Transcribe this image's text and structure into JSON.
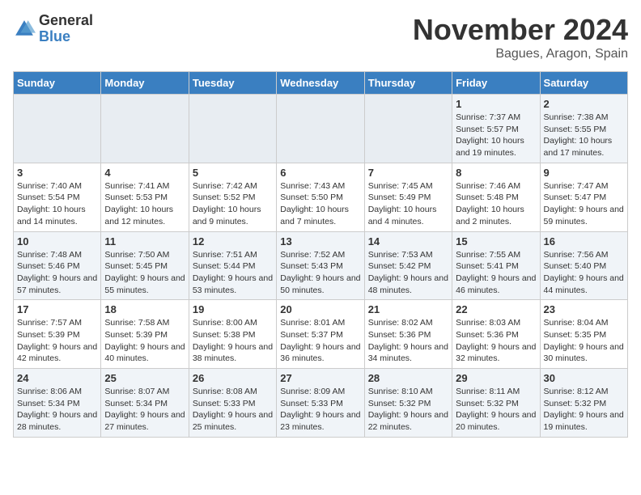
{
  "header": {
    "logo_general": "General",
    "logo_blue": "Blue",
    "month_title": "November 2024",
    "location": "Bagues, Aragon, Spain"
  },
  "weekdays": [
    "Sunday",
    "Monday",
    "Tuesday",
    "Wednesday",
    "Thursday",
    "Friday",
    "Saturday"
  ],
  "weeks": [
    [
      {
        "day": "",
        "info": ""
      },
      {
        "day": "",
        "info": ""
      },
      {
        "day": "",
        "info": ""
      },
      {
        "day": "",
        "info": ""
      },
      {
        "day": "",
        "info": ""
      },
      {
        "day": "1",
        "info": "Sunrise: 7:37 AM\nSunset: 5:57 PM\nDaylight: 10 hours and 19 minutes."
      },
      {
        "day": "2",
        "info": "Sunrise: 7:38 AM\nSunset: 5:55 PM\nDaylight: 10 hours and 17 minutes."
      }
    ],
    [
      {
        "day": "3",
        "info": "Sunrise: 7:40 AM\nSunset: 5:54 PM\nDaylight: 10 hours and 14 minutes."
      },
      {
        "day": "4",
        "info": "Sunrise: 7:41 AM\nSunset: 5:53 PM\nDaylight: 10 hours and 12 minutes."
      },
      {
        "day": "5",
        "info": "Sunrise: 7:42 AM\nSunset: 5:52 PM\nDaylight: 10 hours and 9 minutes."
      },
      {
        "day": "6",
        "info": "Sunrise: 7:43 AM\nSunset: 5:50 PM\nDaylight: 10 hours and 7 minutes."
      },
      {
        "day": "7",
        "info": "Sunrise: 7:45 AM\nSunset: 5:49 PM\nDaylight: 10 hours and 4 minutes."
      },
      {
        "day": "8",
        "info": "Sunrise: 7:46 AM\nSunset: 5:48 PM\nDaylight: 10 hours and 2 minutes."
      },
      {
        "day": "9",
        "info": "Sunrise: 7:47 AM\nSunset: 5:47 PM\nDaylight: 9 hours and 59 minutes."
      }
    ],
    [
      {
        "day": "10",
        "info": "Sunrise: 7:48 AM\nSunset: 5:46 PM\nDaylight: 9 hours and 57 minutes."
      },
      {
        "day": "11",
        "info": "Sunrise: 7:50 AM\nSunset: 5:45 PM\nDaylight: 9 hours and 55 minutes."
      },
      {
        "day": "12",
        "info": "Sunrise: 7:51 AM\nSunset: 5:44 PM\nDaylight: 9 hours and 53 minutes."
      },
      {
        "day": "13",
        "info": "Sunrise: 7:52 AM\nSunset: 5:43 PM\nDaylight: 9 hours and 50 minutes."
      },
      {
        "day": "14",
        "info": "Sunrise: 7:53 AM\nSunset: 5:42 PM\nDaylight: 9 hours and 48 minutes."
      },
      {
        "day": "15",
        "info": "Sunrise: 7:55 AM\nSunset: 5:41 PM\nDaylight: 9 hours and 46 minutes."
      },
      {
        "day": "16",
        "info": "Sunrise: 7:56 AM\nSunset: 5:40 PM\nDaylight: 9 hours and 44 minutes."
      }
    ],
    [
      {
        "day": "17",
        "info": "Sunrise: 7:57 AM\nSunset: 5:39 PM\nDaylight: 9 hours and 42 minutes."
      },
      {
        "day": "18",
        "info": "Sunrise: 7:58 AM\nSunset: 5:39 PM\nDaylight: 9 hours and 40 minutes."
      },
      {
        "day": "19",
        "info": "Sunrise: 8:00 AM\nSunset: 5:38 PM\nDaylight: 9 hours and 38 minutes."
      },
      {
        "day": "20",
        "info": "Sunrise: 8:01 AM\nSunset: 5:37 PM\nDaylight: 9 hours and 36 minutes."
      },
      {
        "day": "21",
        "info": "Sunrise: 8:02 AM\nSunset: 5:36 PM\nDaylight: 9 hours and 34 minutes."
      },
      {
        "day": "22",
        "info": "Sunrise: 8:03 AM\nSunset: 5:36 PM\nDaylight: 9 hours and 32 minutes."
      },
      {
        "day": "23",
        "info": "Sunrise: 8:04 AM\nSunset: 5:35 PM\nDaylight: 9 hours and 30 minutes."
      }
    ],
    [
      {
        "day": "24",
        "info": "Sunrise: 8:06 AM\nSunset: 5:34 PM\nDaylight: 9 hours and 28 minutes."
      },
      {
        "day": "25",
        "info": "Sunrise: 8:07 AM\nSunset: 5:34 PM\nDaylight: 9 hours and 27 minutes."
      },
      {
        "day": "26",
        "info": "Sunrise: 8:08 AM\nSunset: 5:33 PM\nDaylight: 9 hours and 25 minutes."
      },
      {
        "day": "27",
        "info": "Sunrise: 8:09 AM\nSunset: 5:33 PM\nDaylight: 9 hours and 23 minutes."
      },
      {
        "day": "28",
        "info": "Sunrise: 8:10 AM\nSunset: 5:32 PM\nDaylight: 9 hours and 22 minutes."
      },
      {
        "day": "29",
        "info": "Sunrise: 8:11 AM\nSunset: 5:32 PM\nDaylight: 9 hours and 20 minutes."
      },
      {
        "day": "30",
        "info": "Sunrise: 8:12 AM\nSunset: 5:32 PM\nDaylight: 9 hours and 19 minutes."
      }
    ]
  ]
}
